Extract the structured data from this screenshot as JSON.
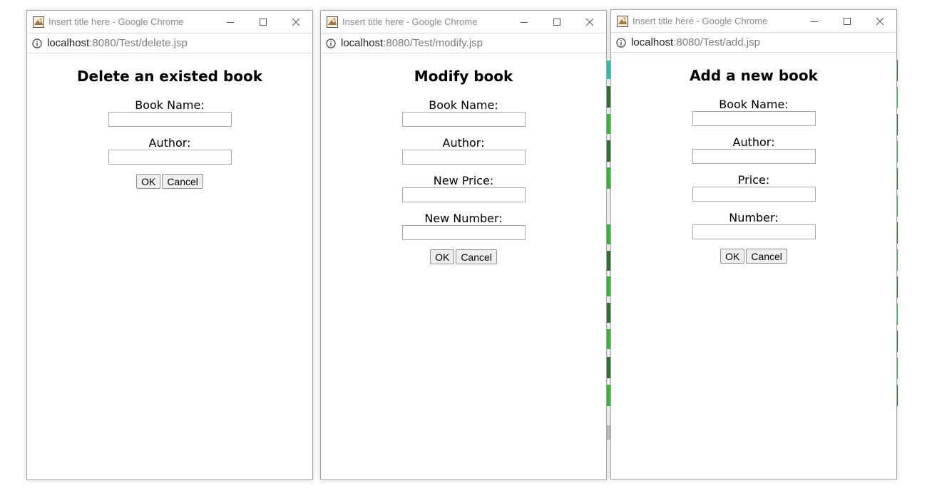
{
  "background": {
    "strip_colors": [
      "#2fd3b5",
      "#ffffff",
      "#2e7d32",
      "#c8c8c8",
      "#38c83a"
    ],
    "right_strip_color": "#2e7d32"
  },
  "windows": [
    {
      "title": "Insert title here - Google Chrome",
      "url_host": "localhost",
      "url_path": ":8080/Test/delete.jsp",
      "heading": "Delete an existed book",
      "fields": [
        {
          "label": "Book Name:",
          "value": ""
        },
        {
          "label": "Author:",
          "value": ""
        }
      ],
      "ok_label": "OK",
      "cancel_label": "Cancel"
    },
    {
      "title": "Insert title here - Google Chrome",
      "url_host": "localhost",
      "url_path": ":8080/Test/modify.jsp",
      "heading": "Modify book",
      "fields": [
        {
          "label": "Book Name:",
          "value": ""
        },
        {
          "label": "Author:",
          "value": ""
        },
        {
          "label": "New Price:",
          "value": ""
        },
        {
          "label": "New Number:",
          "value": ""
        }
      ],
      "ok_label": "OK",
      "cancel_label": "Cancel"
    },
    {
      "title": "Insert title here - Google Chrome",
      "url_host": "localhost",
      "url_path": ":8080/Test/add.jsp",
      "heading": "Add a new book",
      "fields": [
        {
          "label": "Book Name:",
          "value": ""
        },
        {
          "label": "Author:",
          "value": ""
        },
        {
          "label": "Price:",
          "value": ""
        },
        {
          "label": "Number:",
          "value": ""
        }
      ],
      "ok_label": "OK",
      "cancel_label": "Cancel"
    }
  ]
}
